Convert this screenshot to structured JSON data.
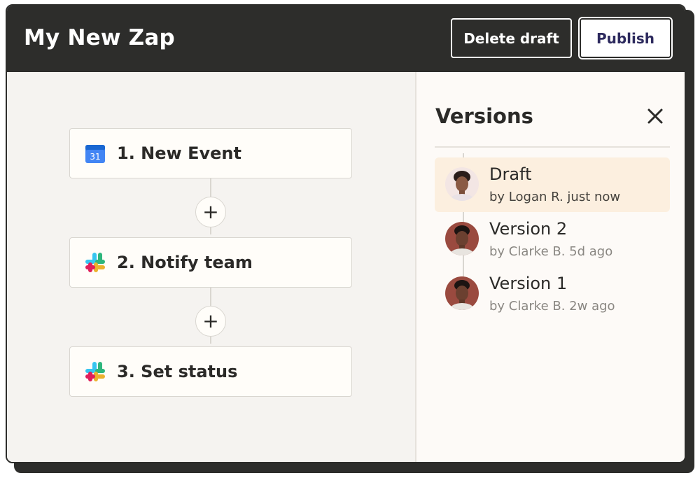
{
  "header": {
    "title": "My New Zap",
    "delete_label": "Delete draft",
    "publish_label": "Publish"
  },
  "steps": [
    {
      "label": "1. New Event",
      "icon": "google-calendar-icon",
      "icon_text": "31"
    },
    {
      "label": "2. Notify team",
      "icon": "slack-icon"
    },
    {
      "label": "3. Set status",
      "icon": "slack-icon"
    }
  ],
  "add_step_symbol": "+",
  "versions_panel": {
    "title": "Versions",
    "items": [
      {
        "name": "Draft",
        "meta": "by Logan R. just now",
        "active": true
      },
      {
        "name": "Version 2",
        "meta": "by Clarke B. 5d ago",
        "active": false
      },
      {
        "name": "Version 1",
        "meta": "by Clarke B. 2w ago",
        "active": false
      }
    ]
  },
  "colors": {
    "header_bg": "#2d2d2b",
    "publish_text": "#2d2a5e",
    "active_version_bg": "#fcefdf",
    "slack_red": "#e01e5a",
    "slack_green": "#2eb67d",
    "slack_blue": "#36c5f0",
    "slack_yellow": "#ecb22e",
    "calendar_blue": "#4285f4"
  }
}
